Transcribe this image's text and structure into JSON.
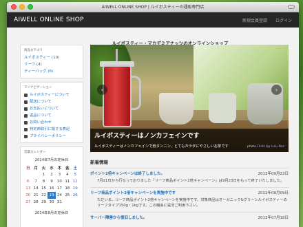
{
  "window": {
    "title": "AIWELL ONLINE SHOP | ルイボスティーの通販専門店"
  },
  "header": {
    "brand": "AIWELL ONLINE SHOP",
    "register": "新規会員登録",
    "login": "ログイン"
  },
  "tagline": "ルイボスティー・マカデミアナッツのオンラインショップ",
  "categories": {
    "title": "商品カテゴリ",
    "items": [
      {
        "label": "ルイボスティー (10)"
      },
      {
        "label": "リーフ (4)"
      },
      {
        "label": "ティーバッグ (6)"
      }
    ]
  },
  "navigation": {
    "title": "マイナビゲーション",
    "items": [
      {
        "label": "ルイボスティーについて",
        "icon": "leaf-icon"
      },
      {
        "label": "配送について",
        "icon": "truck-icon"
      },
      {
        "label": "お支払いについて",
        "icon": "card-icon"
      },
      {
        "label": "返品について",
        "icon": "return-icon"
      },
      {
        "label": "お問い合わせ",
        "icon": "mail-icon"
      },
      {
        "label": "特定商取引に関する表記",
        "icon": "document-icon"
      },
      {
        "label": "プライバシーポリシー",
        "icon": "lock-icon"
      }
    ]
  },
  "calendar": {
    "title": "営業カレンダー",
    "caption": "2014年7月の定休日",
    "weekdays": [
      "日",
      "月",
      "火",
      "水",
      "木",
      "金",
      "土"
    ],
    "weeks": [
      [
        "",
        "",
        "1",
        "2",
        "3",
        "4",
        "5"
      ],
      [
        "6",
        "7",
        "8",
        "9",
        "10",
        "11",
        "12"
      ],
      [
        "13",
        "14",
        "15",
        "16",
        "17",
        "18",
        "19"
      ],
      [
        "20",
        "21",
        "22",
        "23",
        "24",
        "25",
        "26"
      ],
      [
        "27",
        "28",
        "29",
        "30",
        "31",
        "",
        ""
      ]
    ],
    "today": "23",
    "next_caption": "2014年8月の定休日"
  },
  "slider": {
    "title": "ルイボスティーはノンカフェインです",
    "text": "ルイボスティーはノンカフェインで低タンニン、とてもカラダにやさしいお茶です",
    "credit_prefix": "photo",
    "credit_source": "Flickr",
    "credit_by": "by",
    "credit_author": "Lulu Nas",
    "prev": "‹",
    "next": "›"
  },
  "news": {
    "heading": "新着情報",
    "items": [
      {
        "title": "ポイント2倍キャンペーンは終了しました。",
        "date": "2012年09月23日",
        "body": "7月21日から行なっておりました「リーフ商品ポイント2倍キャンペーン」は9月23日をもって終了いたしました。"
      },
      {
        "title": "リーフ商品ポイント2倍キャンペーンを実施中です",
        "date": "2012年08月09日",
        "body": "ただいま、リーフ商品ポイント2倍キャンペーンを実施中です。対象商品はオーガニック&グリーンルイボスティーのリーフタイプ150g・1kgです。この機会に是非ご利用下さい。"
      },
      {
        "title": "サーバー障害から復旧しました。",
        "date": "2012年07月18日",
        "body": ""
      }
    ]
  }
}
